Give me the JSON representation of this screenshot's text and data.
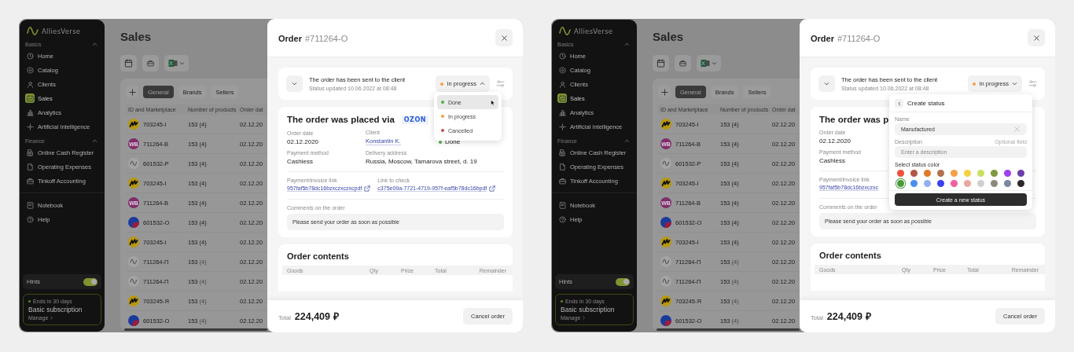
{
  "screens": [
    {
      "sidebar": {
        "brand": "AlliesVerse",
        "sections": [
          {
            "title": "Basics",
            "expanded": true,
            "items": [
              {
                "label": "Home",
                "selected": false
              },
              {
                "label": "Catalog",
                "selected": false
              },
              {
                "label": "Clients",
                "selected": false
              },
              {
                "label": "Sales",
                "selected": true
              },
              {
                "label": "Analytics",
                "selected": false
              },
              {
                "label": "Artificial Intelligence",
                "selected": false
              }
            ]
          },
          {
            "title": "Finance",
            "expanded": true,
            "items": [
              {
                "label": "Online Cash Register",
                "selected": false
              },
              {
                "label": "Operating Expenses",
                "selected": false
              },
              {
                "label": "Tinkoff Accounting",
                "selected": false
              }
            ]
          }
        ],
        "extra_items": [
          {
            "label": "Notebook",
            "selected": false
          },
          {
            "label": "Help",
            "selected": false
          }
        ],
        "hints": {
          "label": "Hints",
          "on": true
        },
        "subscription": {
          "note": "Ends in 30 days",
          "title": "Basic subscription",
          "link": "Manage"
        }
      },
      "sales": {
        "title": "Sales",
        "tabs": [
          {
            "label": "General",
            "selected": true
          },
          {
            "label": "Brands",
            "selected": false
          },
          {
            "label": "Sellers",
            "selected": false
          }
        ],
        "columns": [
          "ID and Marketplace",
          "Number of products",
          "Order dat"
        ],
        "rows": [
          {
            "kind": "m",
            "id": "703245-I",
            "qty": "153",
            "count": "(4)",
            "count_muted": false,
            "date": "02.12.20"
          },
          {
            "kind": "wb",
            "badge": "WB",
            "id": "711264-B",
            "qty": "153",
            "count": "(4)",
            "count_muted": false,
            "date": "02.12.20"
          },
          {
            "kind": "wave",
            "id": "601532-P",
            "qty": "153",
            "count": "(4)",
            "count_muted": false,
            "date": "02.12.20"
          },
          {
            "kind": "m",
            "id": "703245-I",
            "qty": "153",
            "count": "(4)",
            "count_muted": false,
            "date": "02.12.20"
          },
          {
            "kind": "wb",
            "badge": "WB",
            "id": "711264-B",
            "qty": "153",
            "count": "(4)",
            "count_muted": false,
            "date": "02.12.20"
          },
          {
            "kind": "ozon",
            "id": "601532-O",
            "qty": "153",
            "count": "(4)",
            "count_muted": false,
            "date": "02.12.20"
          },
          {
            "kind": "m",
            "id": "703245-I",
            "qty": "153",
            "count": "(4)",
            "count_muted": false,
            "date": "02.12.20"
          },
          {
            "kind": "wave",
            "id": "711264-П",
            "qty": "153",
            "count": "(4)",
            "count_muted": true,
            "date": "02.12.20"
          },
          {
            "kind": "wave",
            "id": "711264-П",
            "qty": "153",
            "count": "(4)",
            "count_muted": true,
            "date": "02.12.20"
          },
          {
            "kind": "m",
            "id": "703245-Я",
            "qty": "153",
            "count": "(4)",
            "count_muted": true,
            "date": "02.12.20"
          },
          {
            "kind": "ozon",
            "id": "601532-O",
            "qty": "153",
            "count": "(4)",
            "count_muted": true,
            "date": "02.12.20"
          }
        ]
      },
      "modal": {
        "title": "Order",
        "number": "#711264-O",
        "status": {
          "message": "The order has been sent to the client",
          "updated": "Status updated 10.06.2022 at 08:48",
          "current": "In progress",
          "color": "#f5a04a",
          "expanded": true
        },
        "status_menu": {
          "options": [
            {
              "label": "Done",
              "color": "#4caf50",
              "hovered": true
            },
            {
              "label": "In progress",
              "color": "#f5a04a",
              "hovered": false
            },
            {
              "label": "Cancelled",
              "color": "#c0504d",
              "hovered": false
            }
          ]
        },
        "info": {
          "heading": "The order was placed via",
          "brand": "OZON",
          "field_rows": [
            [
              {
                "kind": "text",
                "label": "Order date",
                "value": "02.12.2020"
              },
              {
                "kind": "link",
                "label": "Client",
                "value": "Konstantin K."
              },
              {
                "kind": "status",
                "value": "Done",
                "color": "#4caf50"
              }
            ],
            [
              {
                "kind": "text",
                "label": "Payment method",
                "value": "Cashless"
              },
              {
                "kind": "text",
                "label": "Delivery address",
                "value": "Russia, Moscow, Tamarova street, d. 19"
              }
            ]
          ],
          "links": [
            {
              "label": "Payment/invoice link",
              "value": "957faf5b78dc16bzxczxczxcpdf",
              "external": true
            },
            {
              "label": "Link to check",
              "value": "c375e09a-7721-4719-957f-eaf5b78dc16bpdf",
              "external": true
            }
          ],
          "comment_label": "Comments on the order",
          "comment": "Please send your order as soon as possible"
        },
        "contents": {
          "heading": "Order contents",
          "columns": [
            "Goods",
            "Qty",
            "Price",
            "Total",
            "Remainder"
          ]
        },
        "footer": {
          "total_label": "Total",
          "total": "224,409 ₽",
          "cancel": "Cancel order"
        }
      }
    },
    {
      "sidebar": {
        "brand": "AlliesVerse",
        "sections": [
          {
            "title": "Basics",
            "expanded": true,
            "items": [
              {
                "label": "Home",
                "selected": false
              },
              {
                "label": "Catalog",
                "selected": false
              },
              {
                "label": "Clients",
                "selected": false
              },
              {
                "label": "Sales",
                "selected": true
              },
              {
                "label": "Analytics",
                "selected": false
              },
              {
                "label": "Artificial Intelligence",
                "selected": false
              }
            ]
          },
          {
            "title": "Finance",
            "expanded": true,
            "items": [
              {
                "label": "Online Cash Register",
                "selected": false
              },
              {
                "label": "Operating Expenses",
                "selected": false
              },
              {
                "label": "Tinkoff Accounting",
                "selected": false
              }
            ]
          }
        ],
        "extra_items": [
          {
            "label": "Notebook",
            "selected": false
          },
          {
            "label": "Help",
            "selected": false
          }
        ],
        "hints": {
          "label": "Hints",
          "on": true
        },
        "subscription": {
          "note": "Ends in 30 days",
          "title": "Basic subscription",
          "link": "Manage"
        }
      },
      "sales": {
        "title": "Sales",
        "tabs": [
          {
            "label": "General",
            "selected": true
          },
          {
            "label": "Brands",
            "selected": false
          },
          {
            "label": "Sellers",
            "selected": false
          }
        ],
        "columns": [
          "ID and Marketplace",
          "Number of products",
          "Order dat"
        ],
        "rows": [
          {
            "kind": "m",
            "id": "703245-I",
            "qty": "153",
            "count": "(4)",
            "count_muted": false,
            "date": "02.12.20"
          },
          {
            "kind": "wb",
            "badge": "WB",
            "id": "711264-B",
            "qty": "153",
            "count": "(4)",
            "count_muted": false,
            "date": "02.12.20"
          },
          {
            "kind": "wave",
            "id": "601532-P",
            "qty": "153",
            "count": "(4)",
            "count_muted": false,
            "date": "02.12.20"
          },
          {
            "kind": "m",
            "id": "703245-I",
            "qty": "153",
            "count": "(4)",
            "count_muted": false,
            "date": "02.12.20"
          },
          {
            "kind": "wb",
            "badge": "WB",
            "id": "711264-B",
            "qty": "153",
            "count": "(4)",
            "count_muted": false,
            "date": "02.12.20"
          },
          {
            "kind": "ozon",
            "id": "601532-O",
            "qty": "153",
            "count": "(4)",
            "count_muted": false,
            "date": "02.12.20"
          },
          {
            "kind": "m",
            "id": "703245-I",
            "qty": "153",
            "count": "(4)",
            "count_muted": false,
            "date": "02.12.20"
          },
          {
            "kind": "wave",
            "id": "711264-П",
            "qty": "153",
            "count": "(4)",
            "count_muted": true,
            "date": "02.12.20"
          },
          {
            "kind": "wave",
            "id": "711264-П",
            "qty": "153",
            "count": "(4)",
            "count_muted": true,
            "date": "02.12.20"
          },
          {
            "kind": "m",
            "id": "703245-Я",
            "qty": "153",
            "count": "(4)",
            "count_muted": true,
            "date": "02.12.20"
          },
          {
            "kind": "ozon",
            "id": "601532-O",
            "qty": "153",
            "count": "(4)",
            "count_muted": true,
            "date": "02.12.20"
          }
        ]
      },
      "modal": {
        "title": "Order",
        "number": "#711264-O",
        "status": {
          "message": "The order has been sent to the client",
          "updated": "Status updated 10.06.2022 at 08:48",
          "current": "In progress",
          "color": "#f5a04a",
          "expanded": false
        },
        "create_status": {
          "title": "Create status",
          "name_label": "Name",
          "name_value": "Manufactured",
          "description_label": "Description",
          "optional_hint": "Optional field",
          "description_placeholder": "Enter a description",
          "color_label": "Select status color",
          "colors": [
            {
              "color": "#f0503c",
              "selected": false
            },
            {
              "color": "#b0584a",
              "selected": false
            },
            {
              "color": "#e07a2a",
              "selected": false
            },
            {
              "color": "#b07050",
              "selected": false
            },
            {
              "color": "#f5a04a",
              "selected": false
            },
            {
              "color": "#f5d040",
              "selected": false
            },
            {
              "color": "#c8e060",
              "selected": false
            },
            {
              "color": "#809a40",
              "selected": false
            },
            {
              "color": "#a040f0",
              "selected": false
            },
            {
              "color": "#6a40a8",
              "selected": false
            },
            {
              "color": "#4a9a3a",
              "selected": true
            },
            {
              "color": "#4a90f0",
              "selected": false
            },
            {
              "color": "#90b0f0",
              "selected": false
            },
            {
              "color": "#3a40f0",
              "selected": false
            },
            {
              "color": "#f060a0",
              "selected": false
            },
            {
              "color": "#e8a8a0",
              "selected": false
            },
            {
              "color": "#d0d0d0",
              "selected": false
            },
            {
              "color": "#8a8a80",
              "selected": false
            },
            {
              "color": "#7a88a0",
              "selected": false
            },
            {
              "color": "#2a2a2a",
              "selected": false
            }
          ],
          "submit": "Create a new status"
        },
        "info": {
          "heading": "The order was p",
          "field_rows": [
            [
              {
                "kind": "text",
                "label": "Order date",
                "value": "02.12.2020"
              }
            ],
            [
              {
                "kind": "text",
                "label": "Payment method",
                "value": "Cashless"
              }
            ]
          ],
          "links": [
            {
              "label": "Payment/invoice link",
              "value": "957faf5b78dc16bzxczxc",
              "external": false
            }
          ],
          "comment_label": "Comments on the order",
          "comment": "Please send your order as soon as possible"
        },
        "contents": {
          "heading": "Order contents",
          "columns": [
            "Goods",
            "Qty",
            "Price",
            "Total",
            "Remainder"
          ]
        },
        "footer": {
          "total_label": "Total",
          "total": "224,409 ₽",
          "cancel": "Cancel order"
        }
      }
    }
  ]
}
